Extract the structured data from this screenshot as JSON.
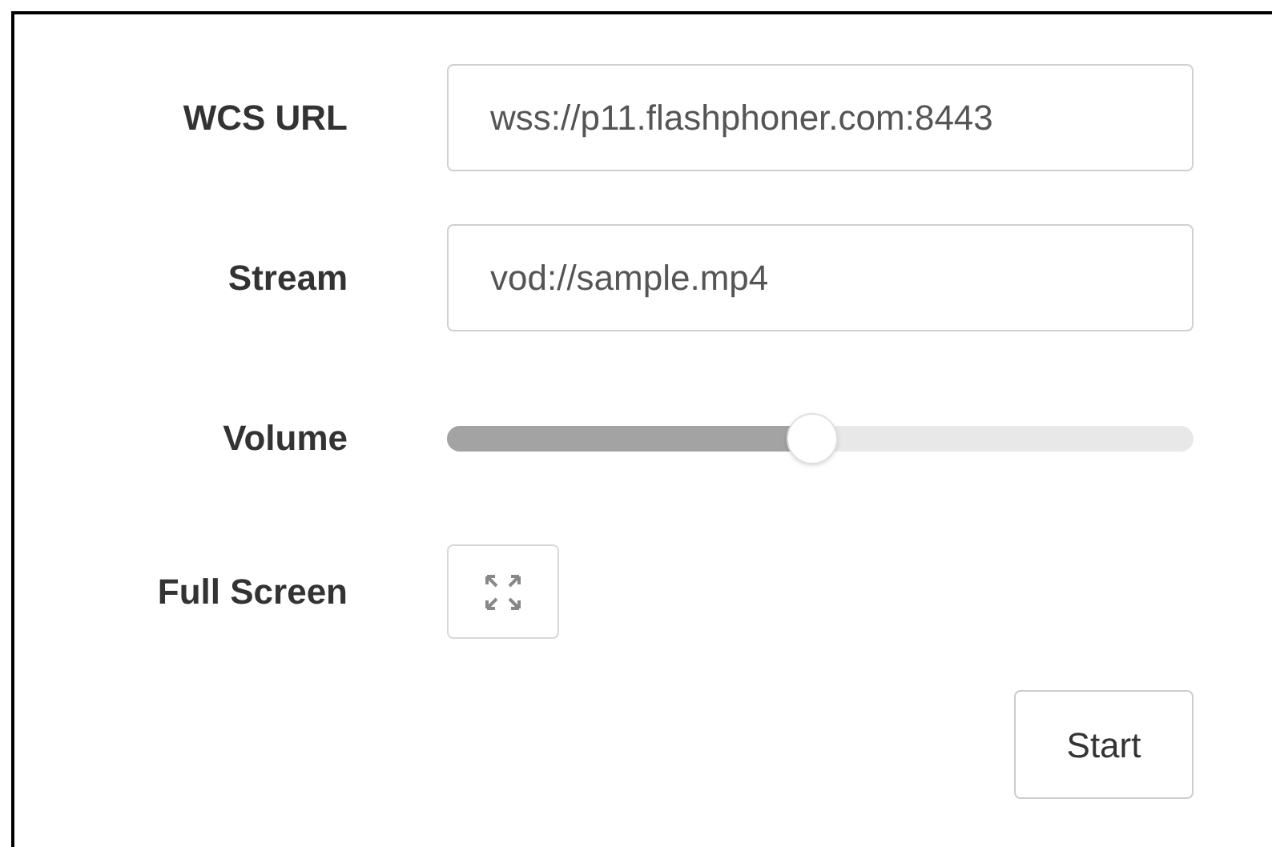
{
  "form": {
    "fields": [
      {
        "kind": "text",
        "label": "WCS URL",
        "value": "wss://p11.flashphoner.com:8443"
      },
      {
        "kind": "text",
        "label": "Stream",
        "value": "vod://sample.mp4"
      },
      {
        "kind": "slider",
        "label": "Volume",
        "level": 0.49
      },
      {
        "kind": "fullscreen",
        "label": "Full Screen"
      }
    ],
    "button": "Start"
  }
}
